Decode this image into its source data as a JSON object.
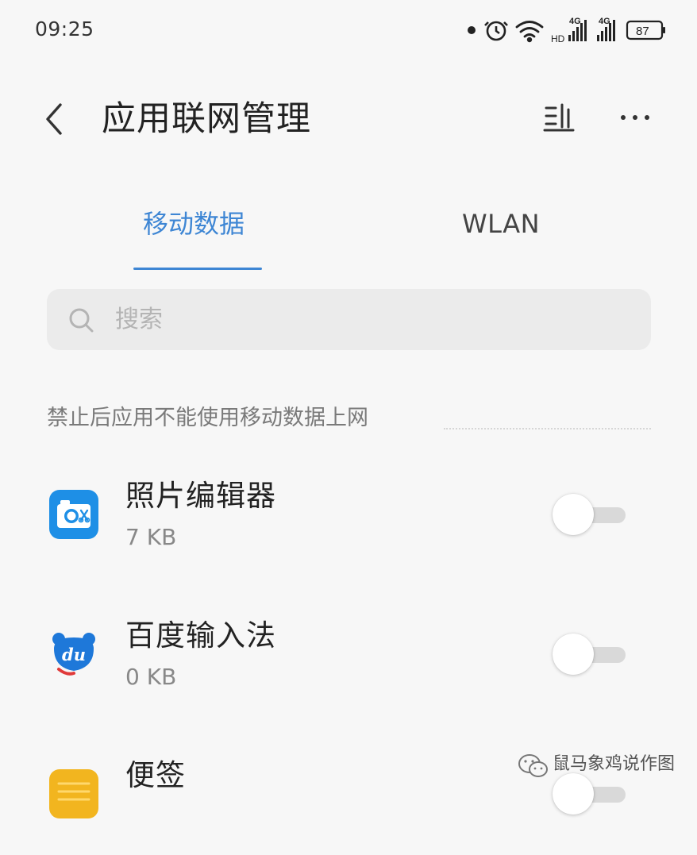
{
  "status_bar": {
    "time": "09:25",
    "network_left": "4G",
    "network_left_sub": "HD",
    "network_right": "4G",
    "battery": "87"
  },
  "header": {
    "title": "应用联网管理"
  },
  "tabs": [
    {
      "label": "移动数据",
      "selected": true
    },
    {
      "label": "WLAN",
      "selected": false
    }
  ],
  "search": {
    "placeholder": "搜索"
  },
  "section": {
    "label": "禁止后应用不能使用移动数据上网"
  },
  "apps": [
    {
      "name": "照片编辑器",
      "usage": "7 KB",
      "enabled": false,
      "icon": "photo-editor-icon"
    },
    {
      "name": "百度输入法",
      "usage": "0 KB",
      "enabled": false,
      "icon": "baidu-input-icon"
    },
    {
      "name": "便签",
      "usage": "",
      "enabled": false,
      "icon": "notes-icon"
    }
  ],
  "watermark": {
    "text": "鼠马象鸡说作图"
  },
  "colors": {
    "accent": "#3e86d4",
    "background": "#f7f7f7",
    "search_bg": "#ebebeb",
    "toggle_track_off": "#d9d9d9"
  }
}
